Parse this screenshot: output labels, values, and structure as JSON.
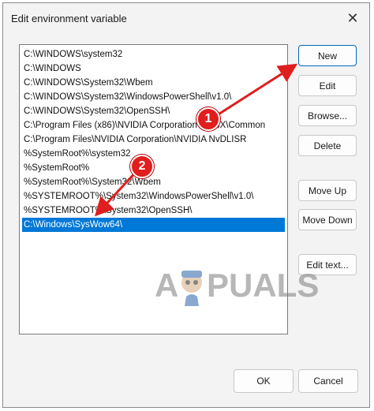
{
  "window": {
    "title": "Edit environment variable",
    "close_glyph": "✕"
  },
  "list": {
    "items": [
      "C:\\WINDOWS\\system32",
      "C:\\WINDOWS",
      "C:\\WINDOWS\\System32\\Wbem",
      "C:\\WINDOWS\\System32\\WindowsPowerShell\\v1.0\\",
      "C:\\WINDOWS\\System32\\OpenSSH\\",
      "C:\\Program Files (x86)\\NVIDIA Corporation\\PhysX\\Common",
      "C:\\Program Files\\NVIDIA Corporation\\NVIDIA NvDLISR",
      "%SystemRoot%\\system32",
      "%SystemRoot%",
      "%SystemRoot%\\System32\\Wbem",
      "%SYSTEMROOT%\\System32\\WindowsPowerShell\\v1.0\\",
      "%SYSTEMROOT%\\System32\\OpenSSH\\",
      "C:\\Windows\\SysWow64\\"
    ],
    "selected_index": 12,
    "selection_color": "#0078d7"
  },
  "buttons": {
    "new": "New",
    "edit": "Edit",
    "browse": "Browse...",
    "delete": "Delete",
    "move_up": "Move Up",
    "move_down": "Move Down",
    "edit_text": "Edit text...",
    "ok": "OK",
    "cancel": "Cancel"
  },
  "annotations": {
    "badge_1": "1",
    "badge_2": "2",
    "arrow_color": "#e01e1e"
  },
  "watermark": {
    "text_left": "A",
    "text_right": "PUALS"
  }
}
